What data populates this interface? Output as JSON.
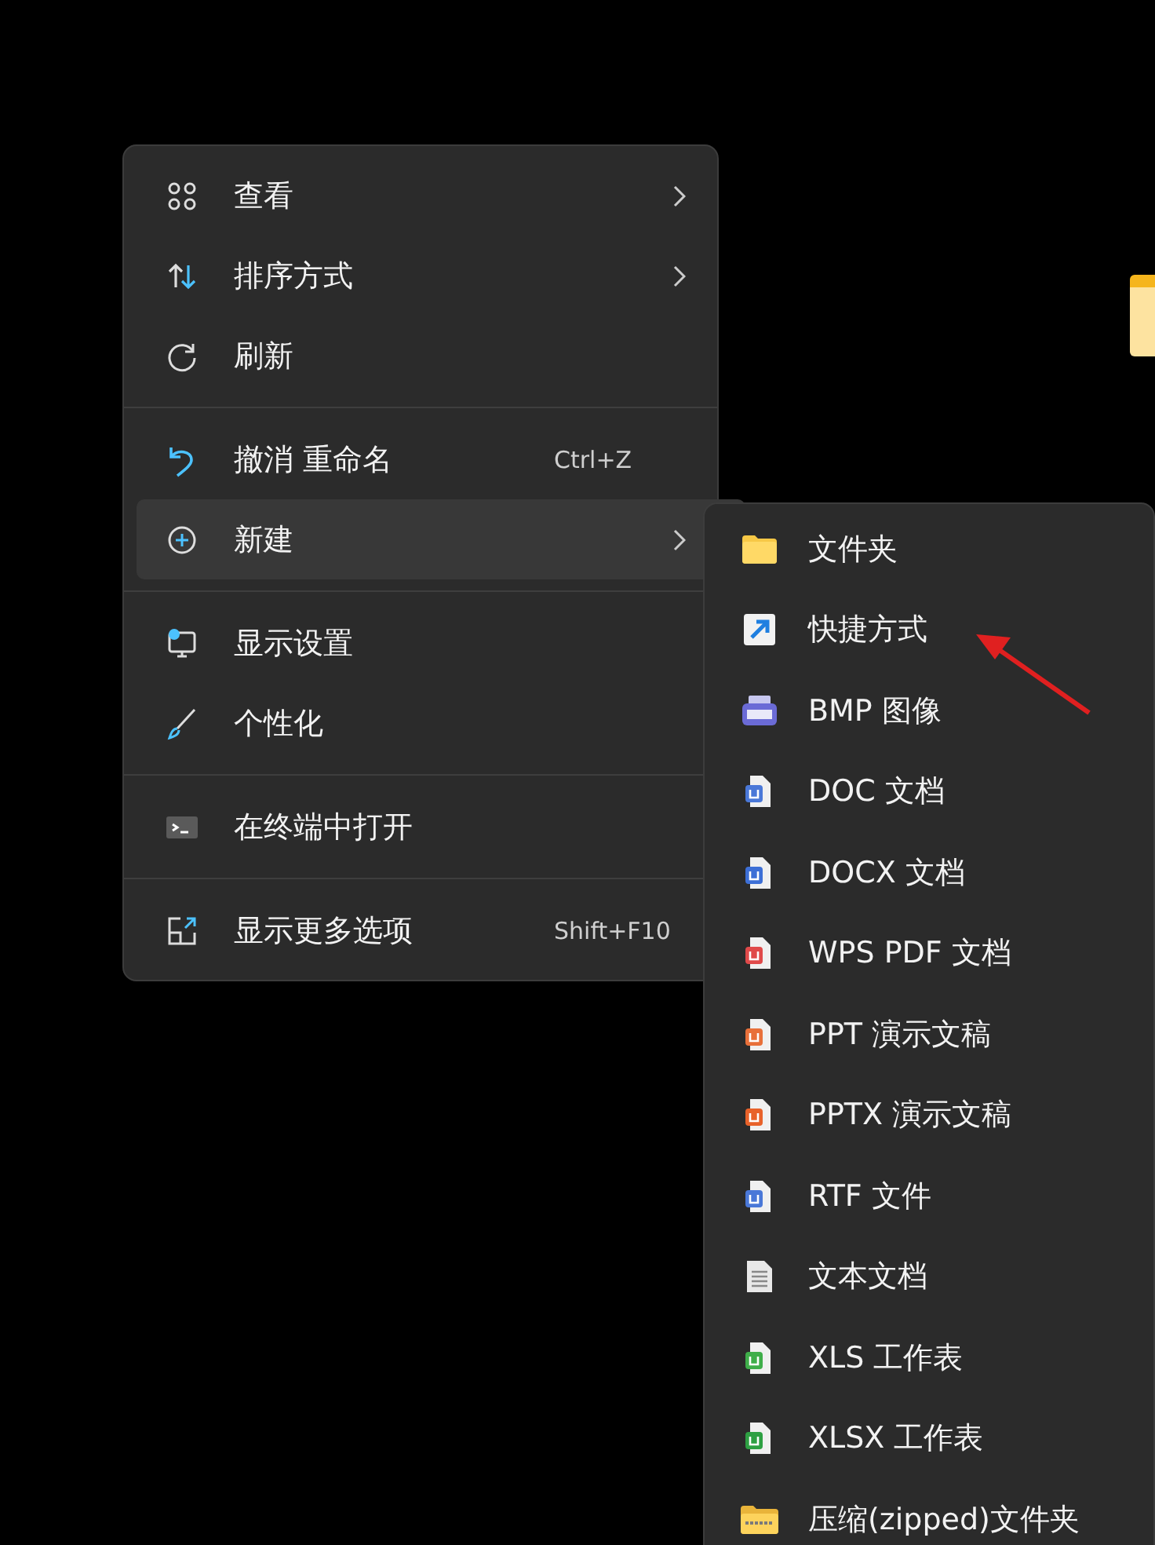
{
  "context_menu": {
    "groups": [
      [
        {
          "kind": "view",
          "label": "查看",
          "submenu": true,
          "selected": false
        },
        {
          "kind": "sort",
          "label": "排序方式",
          "submenu": true,
          "selected": false
        },
        {
          "kind": "refresh",
          "label": "刷新",
          "submenu": false,
          "selected": false
        }
      ],
      [
        {
          "kind": "undo",
          "label": "撤消 重命名",
          "shortcut": "Ctrl+Z",
          "submenu": false,
          "selected": false
        },
        {
          "kind": "new",
          "label": "新建",
          "submenu": true,
          "selected": true
        }
      ],
      [
        {
          "kind": "display",
          "label": "显示设置",
          "submenu": false,
          "selected": false
        },
        {
          "kind": "personalize",
          "label": "个性化",
          "submenu": false,
          "selected": false
        }
      ],
      [
        {
          "kind": "terminal",
          "label": "在终端中打开",
          "submenu": false,
          "selected": false
        }
      ],
      [
        {
          "kind": "more",
          "label": "显示更多选项",
          "shortcut": "Shift+F10",
          "submenu": false,
          "selected": false
        }
      ]
    ]
  },
  "new_submenu": {
    "items": [
      {
        "kind": "folder",
        "label": "文件夹"
      },
      {
        "kind": "shortcut",
        "label": "快捷方式"
      },
      {
        "kind": "bmp",
        "label": "BMP 图像"
      },
      {
        "kind": "doc",
        "label": "DOC 文档",
        "color": "#4a78d8"
      },
      {
        "kind": "doc",
        "label": "DOCX 文档",
        "color": "#3d6fd6"
      },
      {
        "kind": "doc",
        "label": "WPS PDF 文档",
        "color": "#e04a4a"
      },
      {
        "kind": "doc",
        "label": "PPT 演示文稿",
        "color": "#e8703a"
      },
      {
        "kind": "doc",
        "label": "PPTX 演示文稿",
        "color": "#e8622a"
      },
      {
        "kind": "doc",
        "label": "RTF 文件",
        "color": "#4a78d8"
      },
      {
        "kind": "text",
        "label": "文本文档"
      },
      {
        "kind": "doc",
        "label": "XLS 工作表",
        "color": "#3fae4a"
      },
      {
        "kind": "doc",
        "label": "XLSX 工作表",
        "color": "#2ea043"
      },
      {
        "kind": "zip",
        "label": "压缩(zipped)文件夹"
      }
    ]
  }
}
